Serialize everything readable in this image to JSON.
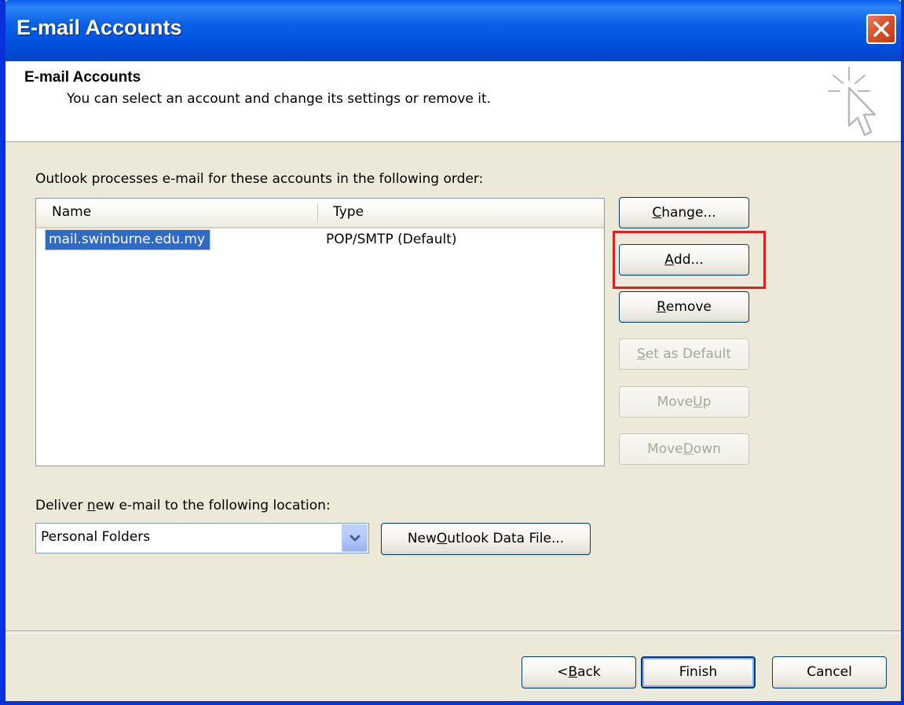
{
  "window": {
    "title": "E-mail Accounts"
  },
  "header": {
    "title": "E-mail Accounts",
    "subtitle": "You can select an account and change its settings or remove it."
  },
  "accounts": {
    "label": "Outlook processes e-mail for these accounts in the following order:",
    "columns": {
      "name": "Name",
      "type": "Type"
    },
    "rows": [
      {
        "name": "mail.swinburne.edu.my",
        "type": "POP/SMTP (Default)",
        "selected": true
      }
    ]
  },
  "side_buttons": {
    "change": {
      "pre": "",
      "key": "C",
      "post": "hange..."
    },
    "add": {
      "pre": "",
      "key": "A",
      "post": "dd..."
    },
    "remove": {
      "pre": "",
      "key": "R",
      "post": "emove"
    },
    "set_default": {
      "pre": "",
      "key": "S",
      "post": "et as Default"
    },
    "move_up": {
      "pre": "Move ",
      "key": "U",
      "post": "p"
    },
    "move_down": {
      "pre": "Move ",
      "key": "D",
      "post": "own"
    }
  },
  "delivery": {
    "label_pre": "Deliver ",
    "label_key": "n",
    "label_post": "ew e-mail to the following location:",
    "selected": "Personal Folders",
    "new_file": {
      "pre": "New ",
      "key": "O",
      "post": "utlook Data File..."
    }
  },
  "footer": {
    "back": {
      "pre": "< ",
      "key": "B",
      "post": "ack"
    },
    "finish": "Finish",
    "cancel": "Cancel"
  },
  "colors": {
    "titlebar": "#0054e3",
    "selection": "#316ac5",
    "highlight_box": "#e02020",
    "dialog_bg": "#ece9d8"
  }
}
